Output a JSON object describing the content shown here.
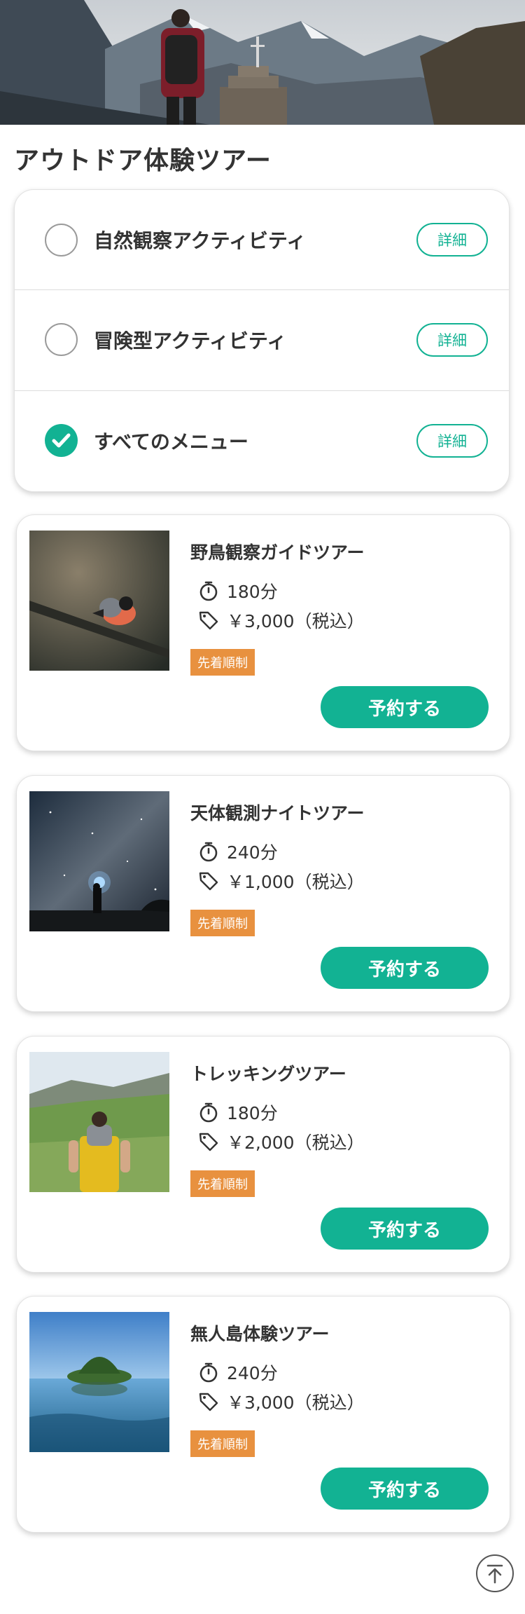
{
  "page": {
    "title": "アウトドア体験ツアー"
  },
  "filters": [
    {
      "label": "自然観察アクティビティ",
      "detail_label": "詳細",
      "selected": false
    },
    {
      "label": "冒険型アクティビティ",
      "detail_label": "詳細",
      "selected": false
    },
    {
      "label": "すべてのメニュー",
      "detail_label": "詳細",
      "selected": true
    }
  ],
  "tours": [
    {
      "name": "野鳥観察ガイドツアー",
      "duration": "180分",
      "price": "￥3,000（税込）",
      "badge": "先着順制",
      "reserve_label": "予約する"
    },
    {
      "name": "天体観測ナイトツアー",
      "duration": "240分",
      "price": "￥1,000（税込）",
      "badge": "先着順制",
      "reserve_label": "予約する"
    },
    {
      "name": "トレッキングツアー",
      "duration": "180分",
      "price": "￥2,000（税込）",
      "badge": "先着順制",
      "reserve_label": "予約する"
    },
    {
      "name": "無人島体験ツアー",
      "duration": "240分",
      "price": "￥3,000（税込）",
      "badge": "先着順制",
      "reserve_label": "予約する"
    }
  ],
  "icons": {
    "timer": "stopwatch-icon",
    "price": "price-tag-icon",
    "selected": "checkmark-icon",
    "scroll_top": "arrow-up-icon"
  },
  "colors": {
    "accent": "#12b293",
    "badge": "#e8913f",
    "text": "#333333"
  }
}
